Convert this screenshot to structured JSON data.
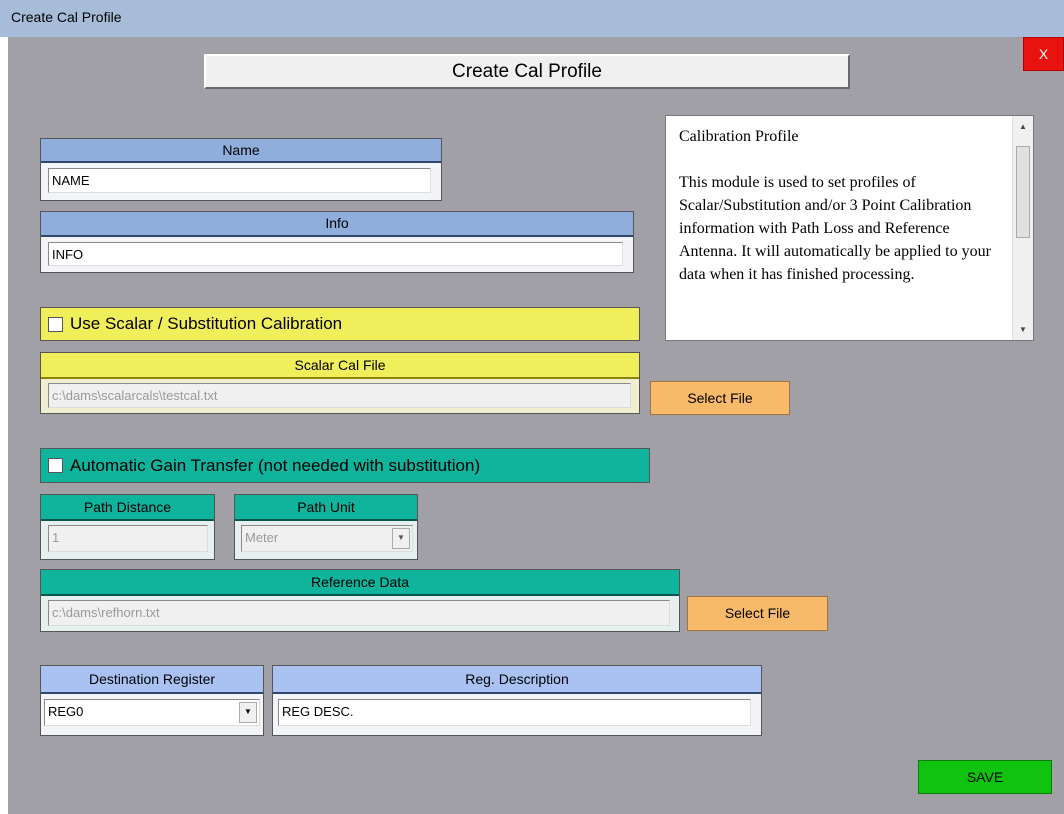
{
  "window": {
    "title": "Create Cal Profile"
  },
  "close_label": "X",
  "page_title": "Create Cal Profile",
  "name": {
    "label": "Name",
    "value": "NAME"
  },
  "info": {
    "label": "Info",
    "value": "INFO"
  },
  "scalar": {
    "checkbox_label": "Use Scalar / Substitution Calibration",
    "checked": false,
    "file_label": "Scalar Cal File",
    "file_value": "c:\\dams\\scalarcals\\testcal.txt",
    "select_label": "Select File"
  },
  "agt": {
    "checkbox_label": "Automatic Gain Transfer (not needed with substitution)",
    "checked": false,
    "path_distance_label": "Path Distance",
    "path_distance_value": "1",
    "path_unit_label": "Path Unit",
    "path_unit_value": "Meter",
    "reference_label": "Reference Data",
    "reference_value": "c:\\dams\\refhorn.txt",
    "select_label": "Select File"
  },
  "destination": {
    "label": "Destination Register",
    "value": "REG0"
  },
  "reg_desc": {
    "label": "Reg. Description",
    "value": "REG DESC."
  },
  "help": {
    "title": "Calibration Profile",
    "body": "This module is used to set profiles of Scalar/Substitution and/or 3 Point Calibration information with Path Loss and Reference Antenna.  It will automatically be applied to your data when it has finished processing."
  },
  "save_label": "SAVE",
  "colors": {
    "client_bg": "#a0a0a6",
    "save": "#0fc30f",
    "close": "#e8130e",
    "select_btn": "#f7b96a"
  }
}
